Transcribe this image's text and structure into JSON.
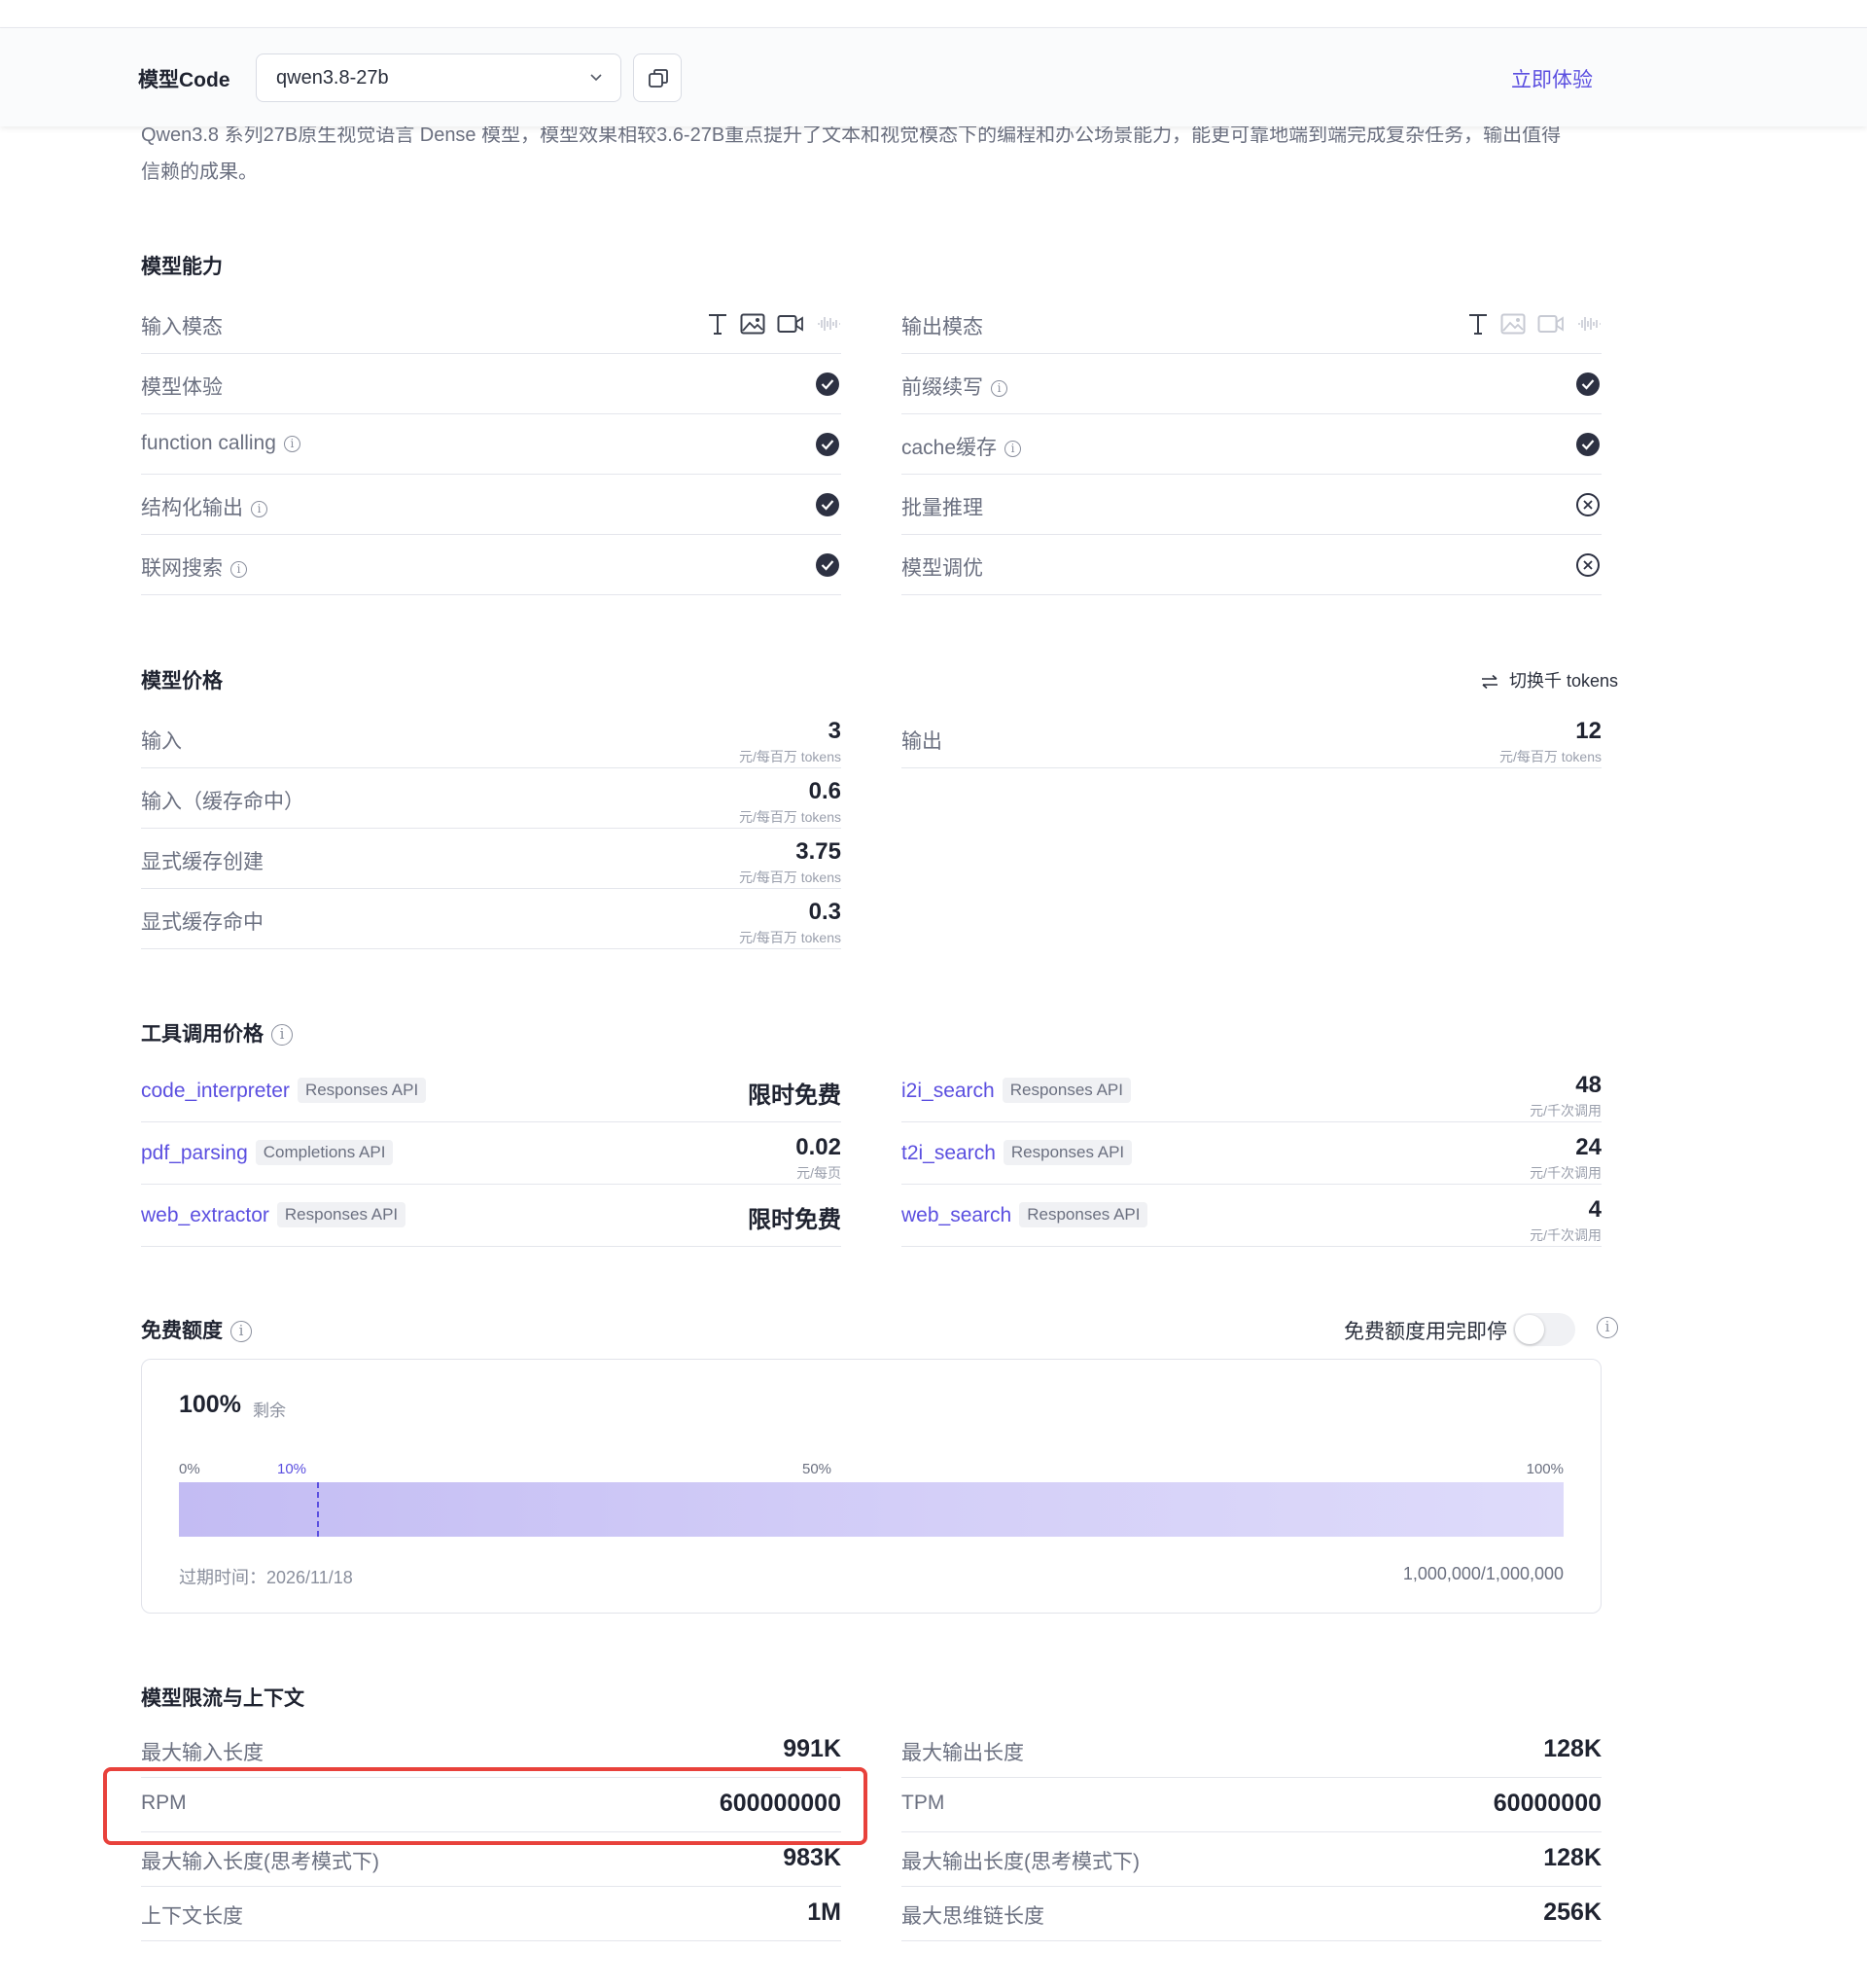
{
  "header": {
    "model_code_label": "模型Code",
    "model_select_value": "qwen3.8-27b",
    "try_label": "立即体验"
  },
  "description": "Qwen3.8 系列27B原生视觉语言 Dense 模型，模型效果相较3.6-27B重点提升了文本和视觉模态下的编程和办公场景能力，能更可靠地端到端完成复杂任务，输出值得信赖的成果。",
  "capabilities": {
    "title": "模型能力",
    "left": [
      {
        "label": "输入模态",
        "icons": [
          "text-icon",
          "image-icon",
          "video-icon",
          "audio-icon"
        ]
      },
      {
        "label": "模型体验",
        "status": "supported"
      },
      {
        "label": "function calling",
        "status": "supported",
        "info": true
      },
      {
        "label": "结构化输出",
        "status": "supported",
        "info": true
      },
      {
        "label": "联网搜索",
        "status": "supported",
        "info": true
      }
    ],
    "right": [
      {
        "label": "输出模态",
        "icons": [
          "text-icon",
          "image-icon",
          "video-icon",
          "audio-icon"
        ]
      },
      {
        "label": "前缀续写",
        "status": "supported",
        "info": true
      },
      {
        "label": "cache缓存",
        "status": "supported",
        "info": true
      },
      {
        "label": "批量推理",
        "status": "unsupported"
      },
      {
        "label": "模型调优",
        "status": "unsupported"
      }
    ]
  },
  "pricing": {
    "title": "模型价格",
    "switch_label": "切换千 tokens",
    "unit": "元/每百万 tokens",
    "left": [
      {
        "label": "输入",
        "value": "3"
      },
      {
        "label": "输入（缓存命中）",
        "value": "0.6"
      },
      {
        "label": "显式缓存创建",
        "value": "3.75"
      },
      {
        "label": "显式缓存命中",
        "value": "0.3"
      }
    ],
    "right": [
      {
        "label": "输出",
        "value": "12"
      }
    ]
  },
  "tools": {
    "title": "工具调用价格",
    "left": [
      {
        "name": "code_interpreter",
        "tag": "Responses API",
        "price": "限时免费",
        "unit": ""
      },
      {
        "name": "pdf_parsing",
        "tag": "Completions API",
        "price": "0.02",
        "unit": "元/每页"
      },
      {
        "name": "web_extractor",
        "tag": "Responses API",
        "price": "限时免费",
        "unit": ""
      }
    ],
    "right": [
      {
        "name": "i2i_search",
        "tag": "Responses API",
        "price": "48",
        "unit": "元/千次调用"
      },
      {
        "name": "t2i_search",
        "tag": "Responses API",
        "price": "24",
        "unit": "元/千次调用"
      },
      {
        "name": "web_search",
        "tag": "Responses API",
        "price": "4",
        "unit": "元/千次调用"
      }
    ]
  },
  "free_quota": {
    "title": "免费额度",
    "stop_label": "免费额度用完即停",
    "stop_enabled": false,
    "remaining_pct": "100%",
    "remaining_label": "剩余",
    "ticks": [
      "0%",
      "10%",
      "50%",
      "100%"
    ],
    "remaining_fraction": 1.0,
    "marker_fraction": 0.1,
    "expire": "过期时间：2026/11/18",
    "count": "1,000,000/1,000,000"
  },
  "limits": {
    "title": "模型限流与上下文",
    "left": [
      {
        "label": "最大输入长度",
        "value": "991K"
      },
      {
        "label": "RPM",
        "value": "600000000"
      },
      {
        "label": "最大输入长度(思考模式下)",
        "value": "983K"
      },
      {
        "label": "上下文长度",
        "value": "1M"
      }
    ],
    "right": [
      {
        "label": "最大输出长度",
        "value": "128K"
      },
      {
        "label": "TPM",
        "value": "60000000"
      },
      {
        "label": "最大输出长度(思考模式下)",
        "value": "128K"
      },
      {
        "label": "最大思维链长度",
        "value": "256K"
      }
    ]
  },
  "colors": {
    "accent": "#5b4fe0",
    "highlight": "#e8413b"
  }
}
